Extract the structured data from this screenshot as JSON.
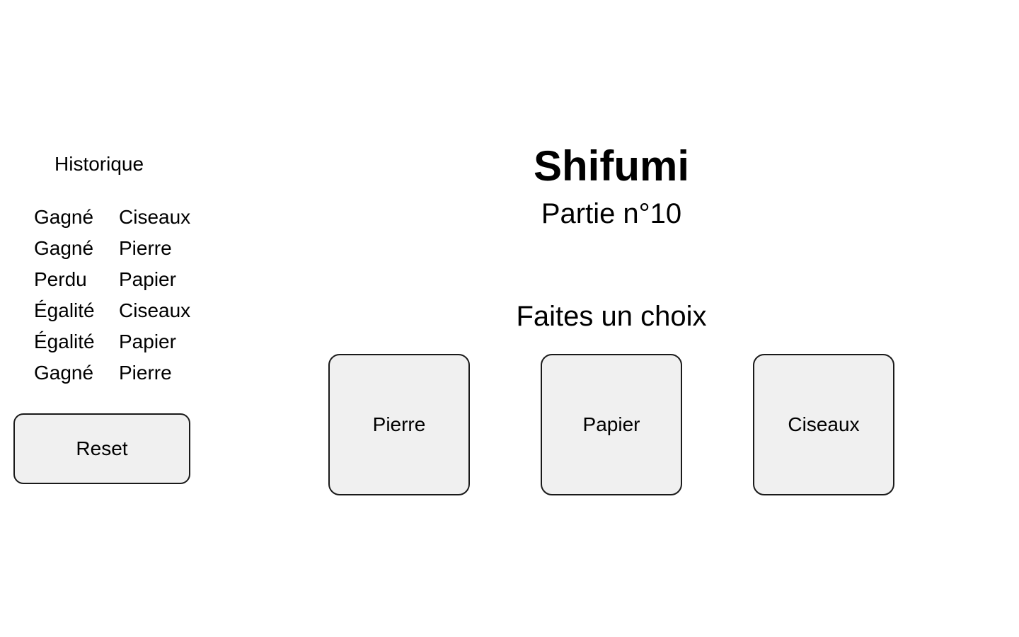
{
  "history": {
    "title": "Historique",
    "rows": [
      {
        "result": "Gagné",
        "choice": "Ciseaux"
      },
      {
        "result": "Gagné",
        "choice": "Pierre"
      },
      {
        "result": "Perdu",
        "choice": "Papier"
      },
      {
        "result": "Égalité",
        "choice": "Ciseaux"
      },
      {
        "result": "Égalité",
        "choice": "Papier"
      },
      {
        "result": "Gagné",
        "choice": "Pierre"
      }
    ],
    "reset_label": "Reset"
  },
  "game": {
    "title": "Shifumi",
    "subtitle": "Partie n°10",
    "prompt": "Faites un choix",
    "choices": [
      "Pierre",
      "Papier",
      "Ciseaux"
    ]
  }
}
